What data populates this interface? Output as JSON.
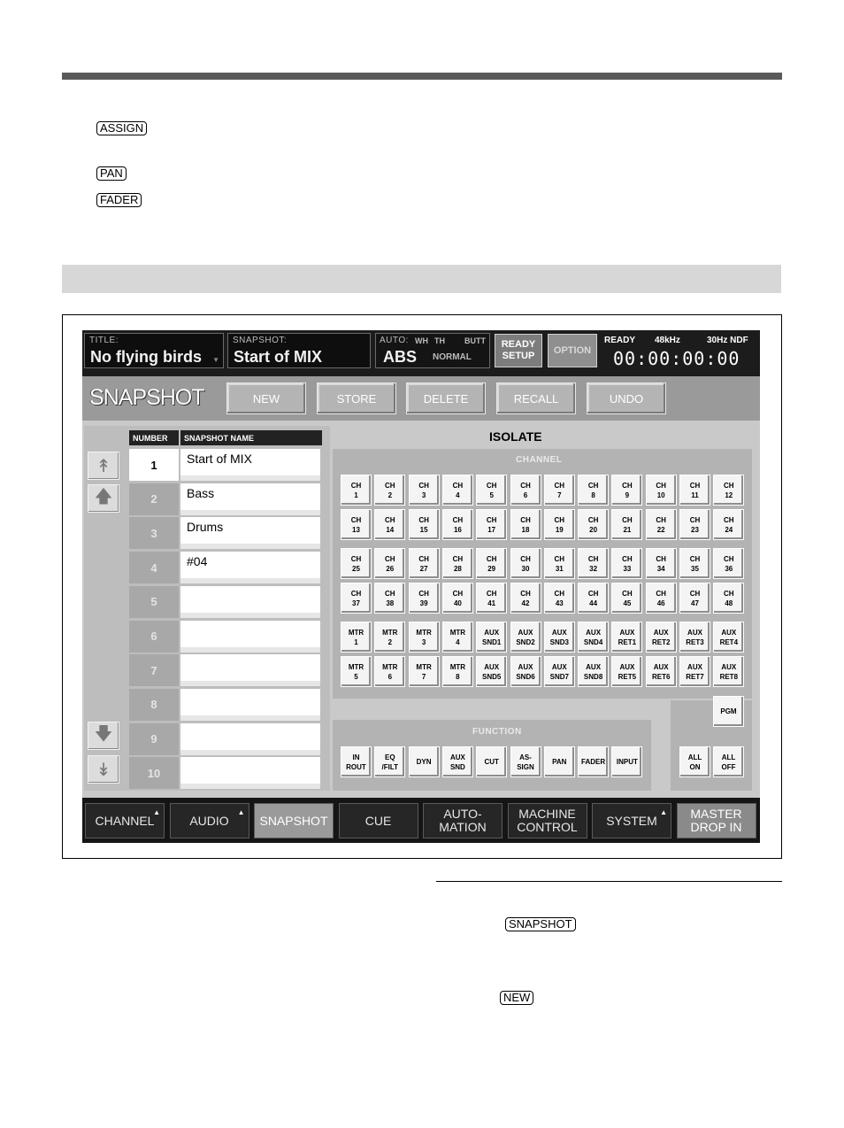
{
  "doc_keys": {
    "assign": "ASSIGN",
    "pan": "PAN",
    "fader": "FADER",
    "snapshot": "SNAPSHOT",
    "new": "NEW"
  },
  "header": {
    "title_label": "TITLE:",
    "title_value": "No flying birds",
    "snapshot_label": "SNAPSHOT:",
    "snapshot_value": "Start of MIX",
    "auto_label": "AUTO:",
    "auto_wh": "WH",
    "auto_th": "TH",
    "auto_butt": "BUTT",
    "auto_value": "ABS",
    "auto_mode": "NORMAL",
    "ready_setup": "READY SETUP",
    "option": "OPTION",
    "status": "READY",
    "sample_rate": "48kHz",
    "frame_rate": "30Hz NDF",
    "timecode": "00:00:00:00"
  },
  "mode_bar": {
    "title": "SNAPSHOT",
    "buttons": [
      "NEW",
      "STORE",
      "DELETE",
      "RECALL",
      "UNDO"
    ]
  },
  "snapshot_list": {
    "col_number": "NUMBER",
    "col_name": "SNAPSHOT NAME",
    "rows": [
      {
        "number": "1",
        "name": "Start of MIX"
      },
      {
        "number": "2",
        "name": "Bass"
      },
      {
        "number": "3",
        "name": "Drums"
      },
      {
        "number": "4",
        "name": "#04"
      },
      {
        "number": "5",
        "name": ""
      },
      {
        "number": "6",
        "name": ""
      },
      {
        "number": "7",
        "name": ""
      },
      {
        "number": "8",
        "name": ""
      },
      {
        "number": "9",
        "name": ""
      },
      {
        "number": "10",
        "name": ""
      }
    ],
    "selected_index": 0
  },
  "isolate": {
    "title": "ISOLATE",
    "channel_label": "CHANNEL",
    "function_label": "FUNCTION",
    "channel_rows": [
      [
        [
          "CH",
          "1"
        ],
        [
          "CH",
          "2"
        ],
        [
          "CH",
          "3"
        ],
        [
          "CH",
          "4"
        ],
        [
          "CH",
          "5"
        ],
        [
          "CH",
          "6"
        ],
        [
          "CH",
          "7"
        ],
        [
          "CH",
          "8"
        ],
        [
          "CH",
          "9"
        ],
        [
          "CH",
          "10"
        ],
        [
          "CH",
          "11"
        ],
        [
          "CH",
          "12"
        ]
      ],
      [
        [
          "CH",
          "13"
        ],
        [
          "CH",
          "14"
        ],
        [
          "CH",
          "15"
        ],
        [
          "CH",
          "16"
        ],
        [
          "CH",
          "17"
        ],
        [
          "CH",
          "18"
        ],
        [
          "CH",
          "19"
        ],
        [
          "CH",
          "20"
        ],
        [
          "CH",
          "21"
        ],
        [
          "CH",
          "22"
        ],
        [
          "CH",
          "23"
        ],
        [
          "CH",
          "24"
        ]
      ],
      [
        [
          "CH",
          "25"
        ],
        [
          "CH",
          "26"
        ],
        [
          "CH",
          "27"
        ],
        [
          "CH",
          "28"
        ],
        [
          "CH",
          "29"
        ],
        [
          "CH",
          "30"
        ],
        [
          "CH",
          "31"
        ],
        [
          "CH",
          "32"
        ],
        [
          "CH",
          "33"
        ],
        [
          "CH",
          "34"
        ],
        [
          "CH",
          "35"
        ],
        [
          "CH",
          "36"
        ]
      ],
      [
        [
          "CH",
          "37"
        ],
        [
          "CH",
          "38"
        ],
        [
          "CH",
          "39"
        ],
        [
          "CH",
          "40"
        ],
        [
          "CH",
          "41"
        ],
        [
          "CH",
          "42"
        ],
        [
          "CH",
          "43"
        ],
        [
          "CH",
          "44"
        ],
        [
          "CH",
          "45"
        ],
        [
          "CH",
          "46"
        ],
        [
          "CH",
          "47"
        ],
        [
          "CH",
          "48"
        ]
      ],
      [
        [
          "MTR",
          "1"
        ],
        [
          "MTR",
          "2"
        ],
        [
          "MTR",
          "3"
        ],
        [
          "MTR",
          "4"
        ],
        [
          "AUX",
          "SND1"
        ],
        [
          "AUX",
          "SND2"
        ],
        [
          "AUX",
          "SND3"
        ],
        [
          "AUX",
          "SND4"
        ],
        [
          "AUX",
          "RET1"
        ],
        [
          "AUX",
          "RET2"
        ],
        [
          "AUX",
          "RET3"
        ],
        [
          "AUX",
          "RET4"
        ]
      ],
      [
        [
          "MTR",
          "5"
        ],
        [
          "MTR",
          "6"
        ],
        [
          "MTR",
          "7"
        ],
        [
          "MTR",
          "8"
        ],
        [
          "AUX",
          "SND5"
        ],
        [
          "AUX",
          "SND6"
        ],
        [
          "AUX",
          "SND7"
        ],
        [
          "AUX",
          "SND8"
        ],
        [
          "AUX",
          "RET5"
        ],
        [
          "AUX",
          "RET6"
        ],
        [
          "AUX",
          "RET7"
        ],
        [
          "AUX",
          "RET8"
        ]
      ]
    ],
    "function_keys": [
      [
        "IN",
        "ROUT"
      ],
      [
        "EQ",
        "/FILT"
      ],
      [
        "DYN",
        ""
      ],
      [
        "AUX",
        "SND"
      ],
      [
        "CUT",
        ""
      ],
      [
        "AS-",
        "SIGN"
      ],
      [
        "PAN",
        ""
      ],
      [
        "FADER",
        ""
      ],
      [
        "INPUT",
        ""
      ]
    ],
    "pgm": "PGM",
    "all_on": [
      "ALL",
      "ON"
    ],
    "all_off": [
      "ALL",
      "OFF"
    ]
  },
  "tabs": [
    {
      "label": "CHANNEL",
      "line2": "",
      "arrow": true
    },
    {
      "label": "AUDIO",
      "line2": "",
      "arrow": true
    },
    {
      "label": "SNAPSHOT",
      "line2": "",
      "arrow": false,
      "active": true
    },
    {
      "label": "CUE",
      "line2": "",
      "arrow": false
    },
    {
      "label": "AUTO-",
      "line2": "MATION",
      "arrow": false
    },
    {
      "label": "MACHINE",
      "line2": "CONTROL",
      "arrow": false
    },
    {
      "label": "SYSTEM",
      "line2": "",
      "arrow": true
    },
    {
      "label": "MASTER",
      "line2": "DROP IN",
      "arrow": false,
      "light": true
    }
  ]
}
